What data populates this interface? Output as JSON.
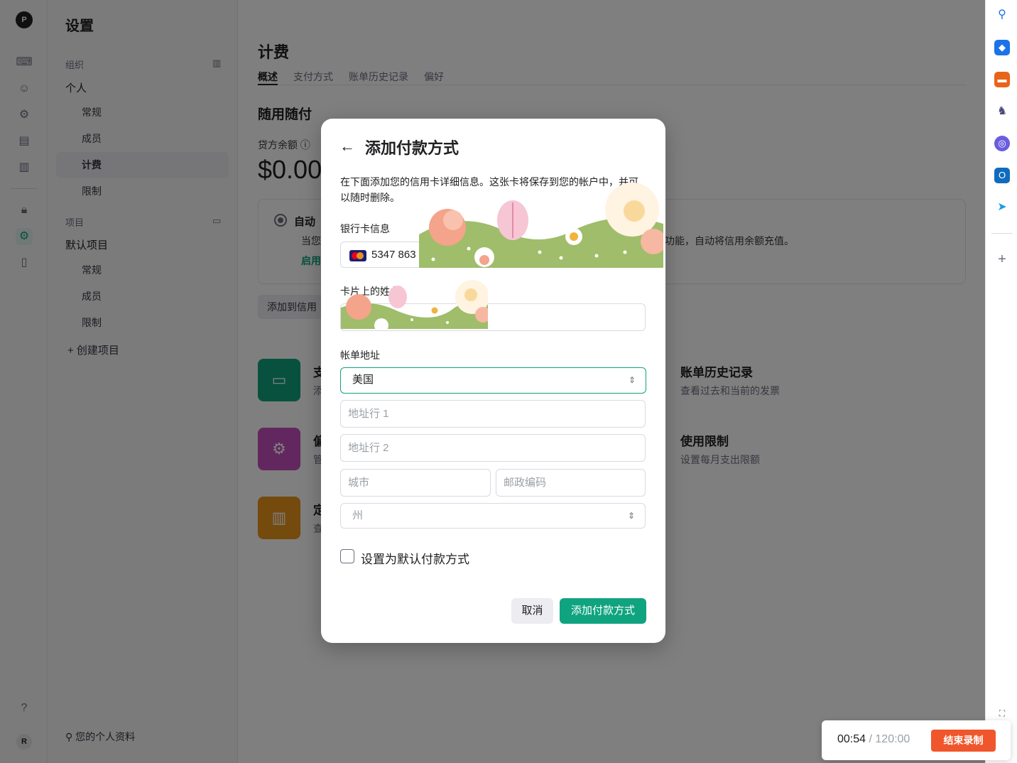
{
  "rail": {
    "logo_letter": "P",
    "avatar_letter": "R"
  },
  "sidenav": {
    "title": "设置",
    "org_section": "组织",
    "personal": "个人",
    "personal_items": [
      "常规",
      "成员",
      "计费",
      "限制"
    ],
    "project_section": "项目",
    "default_project": "默认项目",
    "project_items": [
      "常规",
      "成员",
      "限制"
    ],
    "create_project": "+ 创建项目",
    "profile": "您的个人资料"
  },
  "main": {
    "title": "计费",
    "tabs": [
      "概述",
      "支付方式",
      "账单历史记录",
      "偏好"
    ],
    "pay_as_you_go": "随用随付",
    "credit_label": "贷方余额",
    "credit_amount": "$0.00",
    "auto_title": "自动",
    "auto_desc": "当您",
    "auto_desc_tail": "功能，自动将信用余额充值。",
    "auto_link": "启用",
    "add_credit": "添加到信用",
    "tiles": [
      {
        "title": "支",
        "desc": "添",
        "color": "#10a37f"
      },
      {
        "title": "偏",
        "desc": "管",
        "color": "#c64fc1"
      },
      {
        "title": "定",
        "desc": "查",
        "color": "#e8941a"
      },
      {
        "title": "账单历史记录",
        "desc": "查看过去和当前的发票"
      },
      {
        "title": "使用限制",
        "desc": "设置每月支出限额"
      }
    ]
  },
  "modal": {
    "title": "添加付款方式",
    "intro": "在下面添加您的信用卡详细信息。这张卡将保存到您的帐户中，并可以随时删除。",
    "card_label": "银行卡信息",
    "card_number": "5347 863",
    "name_label": "卡片上的姓名",
    "billing_label": "帐单地址",
    "country": "美国",
    "address1_placeholder": "地址行 1",
    "address2_placeholder": "地址行 2",
    "city_placeholder": "城市",
    "zip_placeholder": "邮政编码",
    "state_placeholder": "州",
    "default_checkbox": "设置为默认付款方式",
    "cancel": "取消",
    "submit": "添加付款方式"
  },
  "recorder": {
    "elapsed": "00:54",
    "separator": " / ",
    "total": "120:00",
    "stop": "结束录制"
  },
  "colors": {
    "accent": "#10a37f",
    "stop": "#f0562b"
  }
}
